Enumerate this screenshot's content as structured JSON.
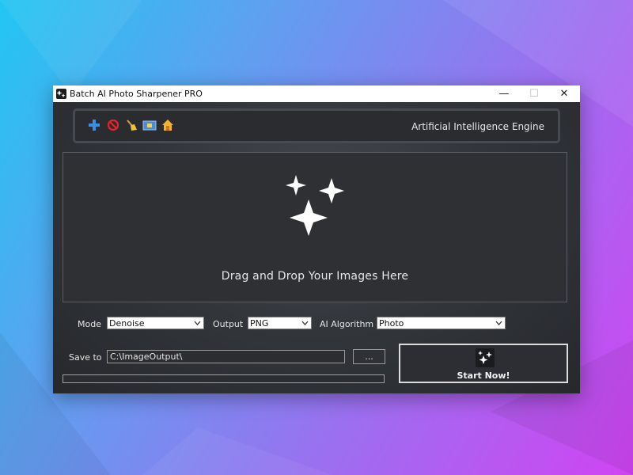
{
  "window": {
    "title": "Batch AI Photo Sharpener PRO",
    "minimize_glyph": "—",
    "maximize_glyph": "☐",
    "close_glyph": "✕"
  },
  "toolbar": {
    "icons": [
      "add-icon",
      "remove-icon",
      "clear-icon",
      "open-folder-icon",
      "home-icon"
    ],
    "engine_label": "Artificial Intelligence Engine"
  },
  "dropzone": {
    "icon": "sparkle-icon",
    "text": "Drag and Drop Your Images Here"
  },
  "settings": {
    "mode_label": "Mode",
    "mode_value": "Denoise",
    "output_label": "Output",
    "output_value": "PNG",
    "algorithm_label": "AI Algorithm",
    "algorithm_value": "Photo",
    "save_to_label": "Save to",
    "save_to_value": "C:\\ImageOutput\\",
    "browse_label": "..."
  },
  "start": {
    "label": "Start Now!",
    "icon": "sparkle-icon"
  },
  "progress": {
    "value": 0
  },
  "colors": {
    "accent_blue": "#3a8ee6",
    "window_bg": "#2b2e33",
    "text": "#e6e6e6"
  }
}
